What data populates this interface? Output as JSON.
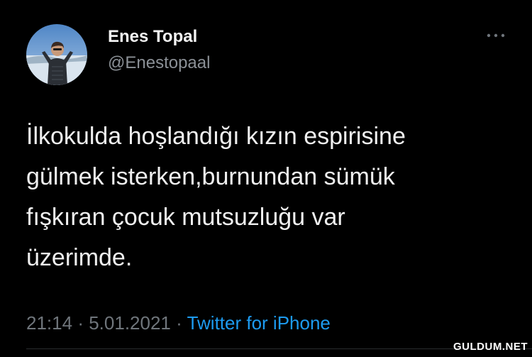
{
  "tweet": {
    "author": {
      "display_name": "Enes Topal",
      "handle": "@Enestopaal",
      "avatar_icon": "profile-photo"
    },
    "more_icon": "more-dots-icon",
    "text_lines": [
      "İlkokulda hoşlandığı kızın espirisine",
      "gülmek isterken,burnundan sümük",
      "fışkıran çocuk mutsuzluğu var",
      "üzerimde."
    ],
    "time": "21:14",
    "separator": "·",
    "date": "5.01.2021",
    "source": "Twitter for iPhone"
  },
  "watermark": "GULDUM.NET",
  "colors": {
    "background": "#000000",
    "text": "#f0f0f0",
    "muted": "#6f757b",
    "link": "#1d9bf0"
  }
}
